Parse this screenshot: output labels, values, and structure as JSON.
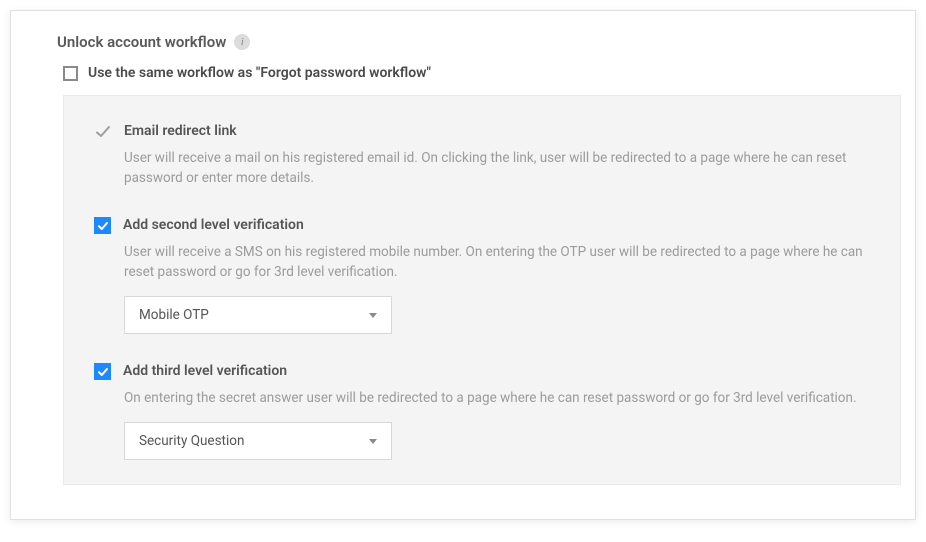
{
  "header": {
    "title": "Unlock account workflow"
  },
  "sameWorkflow": {
    "label": "Use the same workflow as \"Forgot password workflow\"",
    "checked": false
  },
  "steps": {
    "emailRedirect": {
      "title": "Email redirect link",
      "desc": "User will receive a mail on his registered email id. On clicking the link, user will be redirected to a page where he can reset password or enter more details."
    },
    "secondLevel": {
      "title": "Add second level verification",
      "desc": "User will receive a SMS on his registered mobile number. On entering the OTP user will be redirected to a page where he can reset password or go for 3rd level verification.",
      "selected": "Mobile OTP"
    },
    "thirdLevel": {
      "title": "Add third level verification",
      "desc": "On entering the secret answer user will be redirected to a page where he can reset password or go for 3rd level verification.",
      "selected": "Security Question"
    }
  }
}
